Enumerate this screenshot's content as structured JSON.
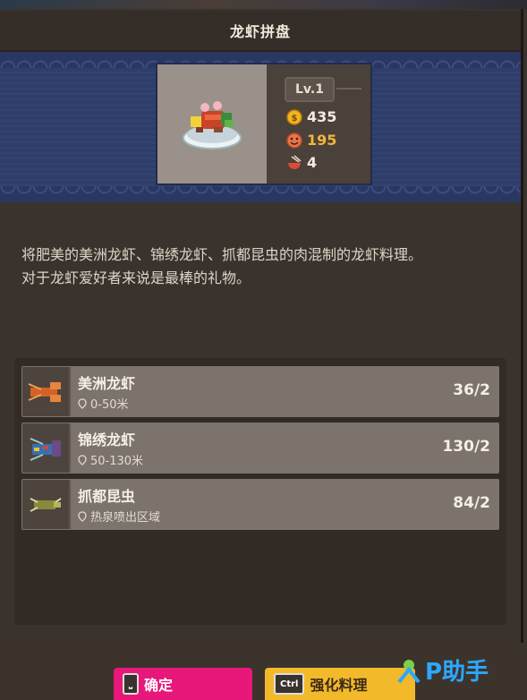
{
  "title": "龙虾拼盘",
  "dish": {
    "image_icon": "lobster-platter-icon",
    "level": "Lv.1",
    "price": "435",
    "love": "195",
    "count": "4"
  },
  "description": {
    "line1": "将肥美的美洲龙虾、锦绣龙虾、抓都昆虫的肉混制的龙虾料理。",
    "line2": "对于龙虾爱好者来说是最棒的礼物。"
  },
  "ingredients": [
    {
      "name": "美洲龙虾",
      "location": "0-50米",
      "count": "36/2",
      "icon": "american-lobster-icon"
    },
    {
      "name": "锦绣龙虾",
      "location": "50-130米",
      "count": "130/2",
      "icon": "painted-lobster-icon"
    },
    {
      "name": "抓都昆虫",
      "location": "热泉喷出区域",
      "count": "84/2",
      "icon": "insect-icon"
    }
  ],
  "buttons": {
    "confirm_key": "⎵",
    "confirm_label": "确定",
    "enhance_key": "Ctrl",
    "enhance_label": "强化料理"
  },
  "watermark": "P助手",
  "colors": {
    "banner": "#2f3d6b",
    "confirm": "#e8177a",
    "enhance": "#f2b92b",
    "love_value": "#f0b63a"
  }
}
